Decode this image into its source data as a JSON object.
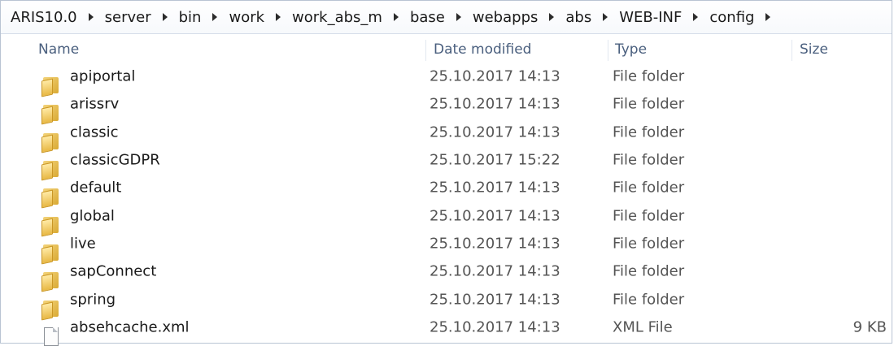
{
  "breadcrumb": [
    "ARIS10.0",
    "server",
    "bin",
    "work",
    "work_abs_m",
    "base",
    "webapps",
    "abs",
    "WEB-INF",
    "config"
  ],
  "columns": {
    "name": "Name",
    "date": "Date modified",
    "type": "Type",
    "size": "Size"
  },
  "items": [
    {
      "name": "apiportal",
      "date": "25.10.2017 14:13",
      "type": "File folder",
      "size": "",
      "icon": "folder-icon"
    },
    {
      "name": "arissrv",
      "date": "25.10.2017 14:13",
      "type": "File folder",
      "size": "",
      "icon": "folder-icon"
    },
    {
      "name": "classic",
      "date": "25.10.2017 14:13",
      "type": "File folder",
      "size": "",
      "icon": "folder-icon"
    },
    {
      "name": "classicGDPR",
      "date": "25.10.2017 15:22",
      "type": "File folder",
      "size": "",
      "icon": "folder-icon"
    },
    {
      "name": "default",
      "date": "25.10.2017 14:13",
      "type": "File folder",
      "size": "",
      "icon": "folder-icon"
    },
    {
      "name": "global",
      "date": "25.10.2017 14:13",
      "type": "File folder",
      "size": "",
      "icon": "folder-icon"
    },
    {
      "name": "live",
      "date": "25.10.2017 14:13",
      "type": "File folder",
      "size": "",
      "icon": "folder-icon"
    },
    {
      "name": "sapConnect",
      "date": "25.10.2017 14:13",
      "type": "File folder",
      "size": "",
      "icon": "folder-icon"
    },
    {
      "name": "spring",
      "date": "25.10.2017 14:13",
      "type": "File folder",
      "size": "",
      "icon": "folder-icon"
    },
    {
      "name": "absehcache.xml",
      "date": "25.10.2017 14:13",
      "type": "XML File",
      "size": "9 KB",
      "icon": "file-icon"
    }
  ],
  "colors": {
    "header_text": "#4a5f7e",
    "folder": "#e8b844"
  }
}
